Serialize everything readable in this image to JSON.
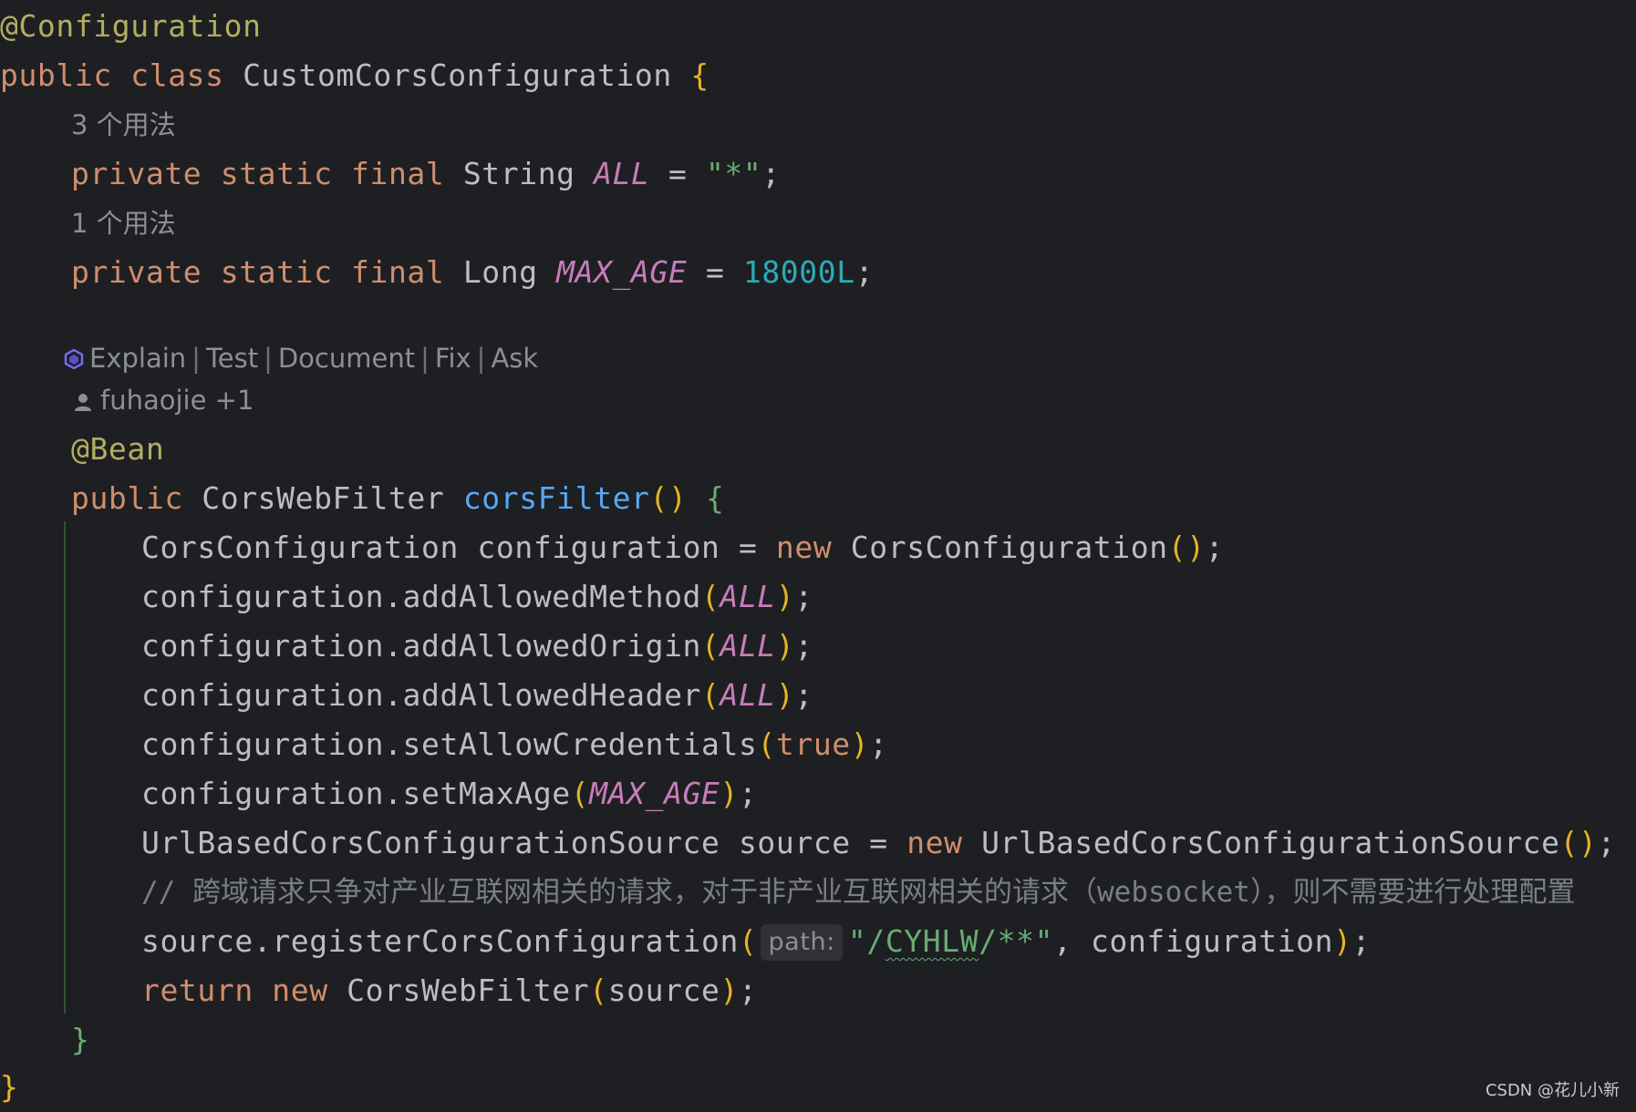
{
  "code": {
    "line_annotation_config": "@Configuration",
    "class_decl": {
      "kw_public": "public",
      "kw_class": "class",
      "class_name": "CustomCorsConfiguration",
      "open_brace": "{"
    },
    "usage_hint_1": "3 个用法",
    "field_all": {
      "kw_private": "private",
      "kw_static": "static",
      "kw_final": "final",
      "type": "String",
      "name": "ALL",
      "eq": "=",
      "value": "\"*\"",
      "semi": ";"
    },
    "usage_hint_2": "1 个用法",
    "field_max_age": {
      "kw_private": "private",
      "kw_static": "static",
      "kw_final": "final",
      "type": "Long",
      "name": "MAX_AGE",
      "eq": "=",
      "value": "18000L",
      "semi": ";"
    },
    "ai_actions": [
      "Explain",
      "Test",
      "Document",
      "Fix",
      "Ask"
    ],
    "author_hint": "fuhaojie +1",
    "bean_annotation": "@Bean",
    "method_decl": {
      "kw_public": "public",
      "return_type": "CorsWebFilter",
      "name": "corsFilter",
      "parens": "()",
      "open_brace": "{"
    },
    "body": {
      "l1_type": "CorsConfiguration",
      "l1_var": "configuration",
      "l1_eq": "=",
      "l1_new": "new",
      "l1_ctor": "CorsConfiguration",
      "l1_tail": ";",
      "l2_call": "configuration.addAllowedMethod",
      "l2_arg": "ALL",
      "l3_call": "configuration.addAllowedOrigin",
      "l3_arg": "ALL",
      "l4_call": "configuration.addAllowedHeader",
      "l4_arg": "ALL",
      "l5_call": "configuration.setAllowCredentials",
      "l5_arg": "true",
      "l6_call": "configuration.setMaxAge",
      "l6_arg": "MAX_AGE",
      "l7_type": "UrlBasedCorsConfigurationSource",
      "l7_var": "source",
      "l7_eq": "=",
      "l7_new": "new",
      "l7_ctor": "UrlBasedCorsConfigurationSource",
      "l8_comment": "// 跨域请求只争对产业互联网相关的请求，对于非产业互联网相关的请求（websocket），则不需要进行处理配置",
      "l9_call": "source.registerCorsConfiguration",
      "l9_hint": "path:",
      "l9_str_open": "\"/",
      "l9_str_word": "CYHLW",
      "l9_str_close": "/**\"",
      "l9_rest": ", configuration",
      "l10_return": "return",
      "l10_new": "new",
      "l10_ctor": "CorsWebFilter",
      "l10_arg": "source"
    },
    "method_close": "}",
    "class_close": "}"
  },
  "watermark": "CSDN @花儿小新",
  "colors": {
    "background": "#1e1f22",
    "keyword": "#cf8e6d",
    "annotation": "#b3ae60",
    "string": "#6aab73",
    "number": "#2aacb8",
    "constant": "#c77dbb",
    "function": "#56a8f5",
    "comment": "#7a7e85",
    "text": "#bcbec4"
  },
  "icons": {
    "ai_assistant": "ai-assistant-icon",
    "author": "user-icon"
  }
}
